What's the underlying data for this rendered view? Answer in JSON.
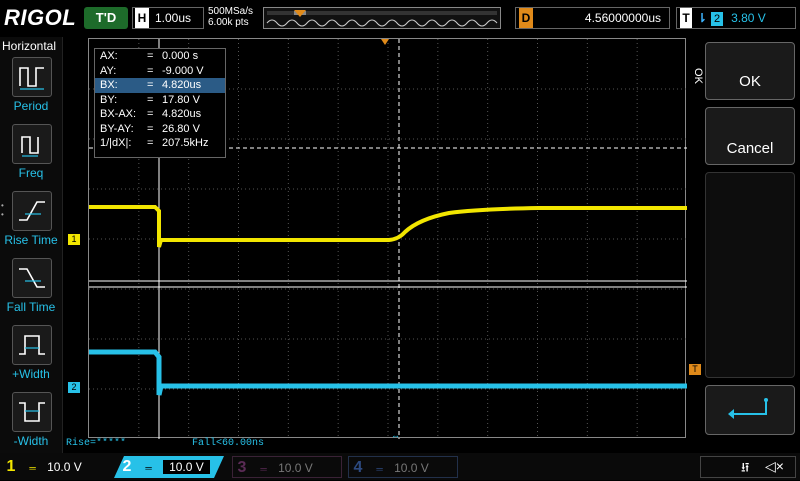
{
  "brand": "RIGOL",
  "top": {
    "run_state": "T'D",
    "horizontal_label": "H",
    "timebase": "1.00us",
    "sample_rate": "500MSa/s",
    "memory_depth": "6.00k pts",
    "delay_label": "D",
    "delay_value": "4.56000000us",
    "trigger_label": "T",
    "trigger_channel": "2",
    "trigger_level": "3.80 V"
  },
  "left_panel": {
    "title": "Horizontal",
    "items": [
      {
        "label": "Period",
        "icon": "period-icon"
      },
      {
        "label": "Freq",
        "icon": "freq-icon"
      },
      {
        "label": "Rise Time",
        "icon": "rise-time-icon"
      },
      {
        "label": "Fall Time",
        "icon": "fall-time-icon"
      },
      {
        "label": "+Width",
        "icon": "positive-width-icon"
      },
      {
        "label": "-Width",
        "icon": "negative-width-icon"
      }
    ]
  },
  "cursor": {
    "rows": [
      {
        "key": "AX:",
        "eq": "=",
        "value": "0.000 s",
        "selected": false
      },
      {
        "key": "AY:",
        "eq": "=",
        "value": "-9.000 V",
        "selected": false
      },
      {
        "key": "BX:",
        "eq": "=",
        "value": "4.820us",
        "selected": true
      },
      {
        "key": "BY:",
        "eq": "=",
        "value": "17.80 V",
        "selected": false
      },
      {
        "key": "BX-AX:",
        "eq": "=",
        "value": "4.820us",
        "selected": false
      },
      {
        "key": "BY-AY:",
        "eq": "=",
        "value": "26.80 V",
        "selected": false
      },
      {
        "key": "1/|dX|:",
        "eq": "=",
        "value": "207.5kHz",
        "selected": false
      }
    ]
  },
  "markers": {
    "ch1": "1",
    "ch2": "2",
    "trigger": "T"
  },
  "right_panel": {
    "side_label": "OK",
    "ok_label": "OK",
    "cancel_label": "Cancel",
    "enter_icon": "enter-icon"
  },
  "measurements": {
    "rise": "Rise=*****",
    "fall": "Fall<60.00ns"
  },
  "channels": [
    {
      "num": "1",
      "scale": "10.0 V",
      "color": "#f2e600",
      "active": true
    },
    {
      "num": "2",
      "scale": "10.0 V",
      "color": "#27c1e8",
      "active": true
    },
    {
      "num": "3",
      "scale": "10.0 V",
      "color": "#c23bb5",
      "active": false
    },
    {
      "num": "4",
      "scale": "10.0 V",
      "color": "#3b6fd6",
      "active": false
    }
  ],
  "status_icons": [
    "usb-icon",
    "speaker-muted-icon"
  ],
  "colors": {
    "ch1": "#f2e600",
    "ch2": "#27c1e8",
    "accent_orange": "#e08a1a",
    "cursor_white": "#ffffff",
    "run_green": "#1d6b2a"
  }
}
